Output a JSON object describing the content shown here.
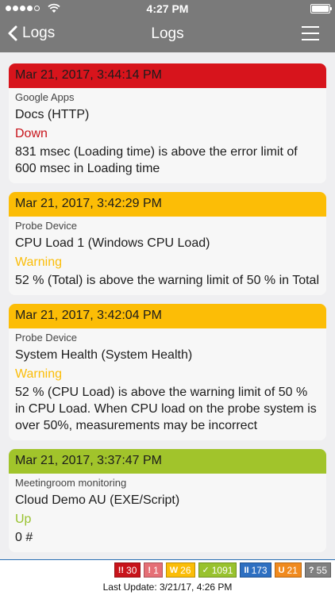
{
  "status_bar": {
    "time": "4:27 PM",
    "signal_bars_filled": 4,
    "signal_bars_total": 5,
    "battery_level": 1.0
  },
  "nav": {
    "back_label": "Logs",
    "title": "Logs",
    "back_icon": "chevron-left-icon",
    "menu_icon": "hamburger-menu-icon"
  },
  "logs": [
    {
      "timestamp": "Mar 21, 2017, 3:44:14 PM",
      "group": "Google Apps",
      "sensor": "Docs (HTTP)",
      "status": "Down",
      "message": "831 msec (Loading time) is above the error limit of 600 msec in Loading time",
      "header_color": "#d7141c"
    },
    {
      "timestamp": "Mar 21, 2017, 3:42:29 PM",
      "group": "Probe Device",
      "sensor": "CPU Load 1 (Windows CPU Load)",
      "status": "Warning",
      "message": "52 % (Total) is above the warning limit of 50 % in Total",
      "header_color": "#fcbd06"
    },
    {
      "timestamp": "Mar 21, 2017, 3:42:04 PM",
      "group": "Probe Device",
      "sensor": "System Health (System Health)",
      "status": "Warning",
      "message": "52 % (CPU Load) is above the warning limit of 50 % in CPU Load. When CPU load on the probe system is over 50%, measurements may be incorrect",
      "header_color": "#fcbd06"
    },
    {
      "timestamp": "Mar 21, 2017, 3:37:47 PM",
      "group": "Meetingroom monitoring",
      "sensor": "Cloud Demo AU (EXE/Script)",
      "status": "Up",
      "message": "0 #",
      "header_color": "#a1c42b"
    }
  ],
  "summary": {
    "badges": [
      {
        "icon": "!!",
        "count": "30",
        "color": "#c8141b"
      },
      {
        "icon": "!",
        "count": "1",
        "color": "#e56f76"
      },
      {
        "icon": "W",
        "count": "26",
        "color": "#fbbd08"
      },
      {
        "icon": "✓",
        "count": "1091",
        "color": "#98c22e"
      },
      {
        "icon": "II",
        "count": "173",
        "color": "#2d6fc1"
      },
      {
        "icon": "U",
        "count": "21",
        "color": "#f08a1e"
      },
      {
        "icon": "?",
        "count": "55",
        "color": "#808080"
      }
    ],
    "last_update": "Last Update: 3/21/17, 4:26 PM"
  }
}
